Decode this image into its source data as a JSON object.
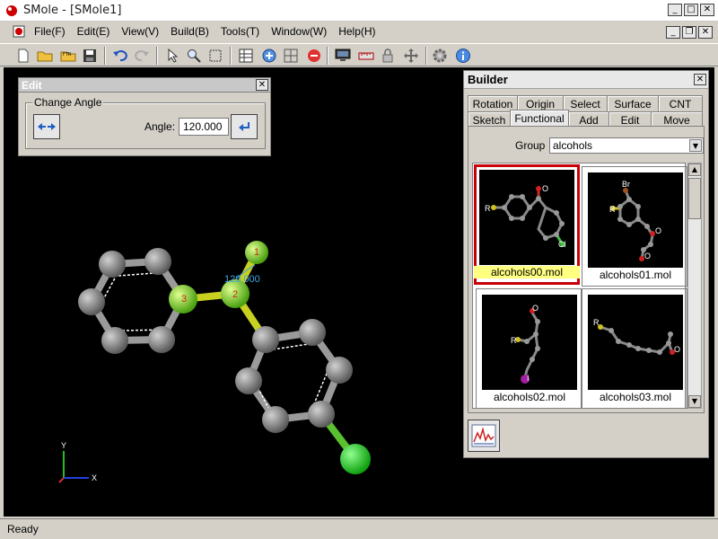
{
  "window": {
    "title": "SMole - [SMole1]",
    "minimize": "_",
    "maximize": "□",
    "close": "✕"
  },
  "menu": {
    "items": [
      "File(F)",
      "Edit(E)",
      "View(V)",
      "Build(B)",
      "Tools(T)",
      "Window(W)",
      "Help(H)"
    ],
    "mdi_minimize": "_",
    "mdi_restore": "❐",
    "mdi_close": "✕"
  },
  "viewport": {
    "atom_labels": [
      "1",
      "2",
      "3"
    ],
    "angle_readout": "120.000",
    "axis_x": "X",
    "axis_y": "Y"
  },
  "edit_panel": {
    "title": "Edit",
    "close": "✕",
    "group_title": "Change Angle",
    "angle_label": "Angle:",
    "angle_value": "120.000"
  },
  "builder": {
    "title": "Builder",
    "close": "✕",
    "tabs_row1": [
      "Rotation",
      "Origin",
      "Select",
      "Surface",
      "CNT"
    ],
    "tabs_row2": [
      "Sketch",
      "Functional",
      "Add",
      "Edit",
      "Move"
    ],
    "active_tab": "Functional",
    "group_label": "Group",
    "group_value": "alcohols",
    "molecules": [
      {
        "label": "alcohols00.mol",
        "selected": true,
        "atom_labels": [
          "R",
          "O",
          "Cl"
        ]
      },
      {
        "label": "alcohols01.mol",
        "selected": false,
        "atom_labels": [
          "Br",
          "R",
          "O",
          "O"
        ]
      },
      {
        "label": "alcohols02.mol",
        "selected": false,
        "atom_labels": [
          "O",
          "R",
          "I"
        ]
      },
      {
        "label": "alcohols03.mol",
        "selected": false,
        "atom_labels": [
          "R",
          "O"
        ]
      }
    ]
  },
  "status": {
    "text": "Ready"
  },
  "colors": {
    "viewport_bg": "#000000",
    "carbon": "#8a8a8a",
    "highlight": "#7fd43a",
    "chlorine": "#22cc22",
    "selection": "#c8000a"
  }
}
